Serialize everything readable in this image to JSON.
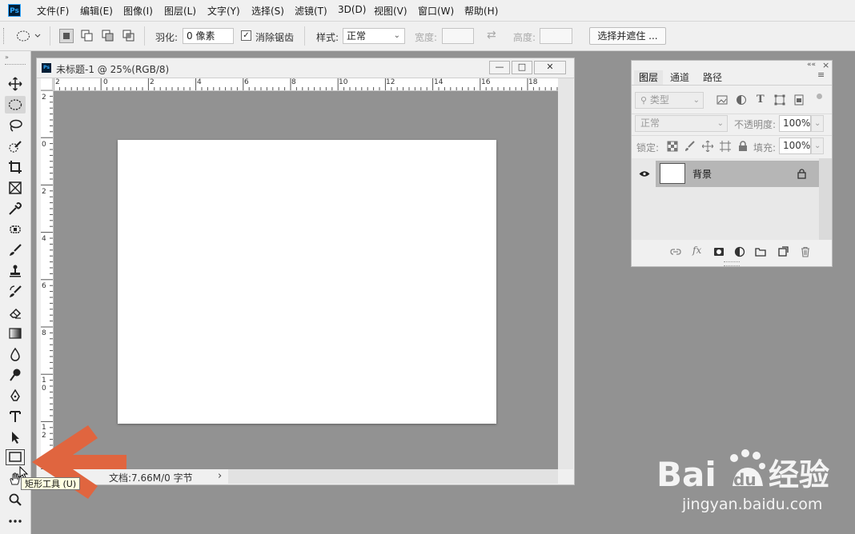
{
  "app": {
    "logo_text": "Ps",
    "menu": [
      "文件(F)",
      "编辑(E)",
      "图像(I)",
      "图层(L)",
      "文字(Y)",
      "选择(S)",
      "滤镜(T)",
      "3D(D)",
      "视图(V)",
      "窗口(W)",
      "帮助(H)"
    ]
  },
  "options_bar": {
    "feather_label": "羽化:",
    "feather_value": "0 像素",
    "antialias_label": "消除锯齿",
    "antialias_checked": true,
    "style_label": "样式:",
    "style_value": "正常",
    "width_label": "宽度:",
    "height_label": "高度:",
    "select_mask_button": "选择并遮住 ..."
  },
  "toolbox": {
    "tools": [
      "move",
      "elliptical-marquee",
      "lasso",
      "quick-selection",
      "crop",
      "frame",
      "eyedropper",
      "healing-brush",
      "brush",
      "clone-stamp",
      "history-brush",
      "eraser",
      "gradient",
      "blur",
      "dodge",
      "pen",
      "type",
      "path-selection",
      "rectangle",
      "hand",
      "zoom",
      "more"
    ],
    "active_tool": "elliptical-marquee",
    "tooltip": "矩形工具 (U)"
  },
  "document": {
    "title": "未标题-1 @ 25%(RGB/8)",
    "tab_icon": "Ps",
    "minimize": "—",
    "maximize": "□",
    "close": "✕",
    "status": "文档:7.66M/0 字节",
    "status_arrow": "›",
    "h_ruler_labels": [
      "2",
      "0",
      "2",
      "4",
      "6",
      "8",
      "10",
      "12",
      "14",
      "16",
      "18"
    ],
    "v_ruler_labels": [
      "2",
      "0",
      "2",
      "4",
      "6",
      "8",
      "1 0",
      "1 2"
    ]
  },
  "layers_panel": {
    "tabs": [
      "图层",
      "通道",
      "路径"
    ],
    "active_tab": "图层",
    "filter_placeholder": "类型",
    "blend_mode": "正常",
    "opacity_label": "不透明度:",
    "opacity_value": "100%",
    "lock_label": "锁定:",
    "fill_label": "填充:",
    "fill_value": "100%",
    "layers": [
      {
        "name": "背景",
        "visible": true,
        "locked": true
      }
    ],
    "collapse_icon": "««",
    "close_icon": "×"
  },
  "watermark": {
    "brand": "Bai du 经验",
    "url": "jingyan.baidu.com"
  },
  "colors": {
    "highlight_arrow": "#e0653f",
    "workspace": "#929292",
    "panel": "#f0f0f0"
  }
}
